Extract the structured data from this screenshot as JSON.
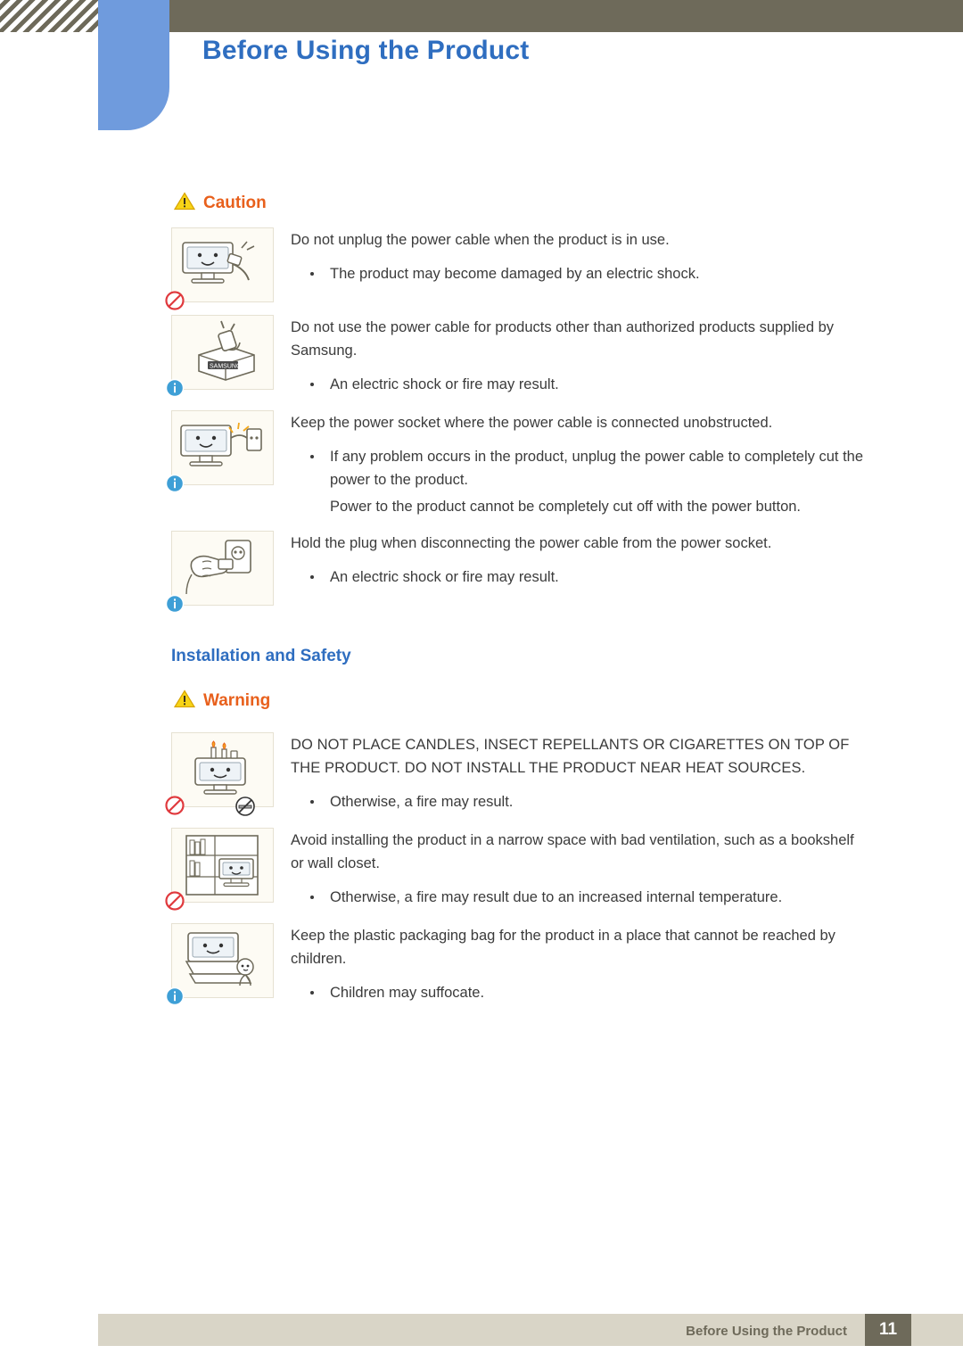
{
  "header": {
    "title": "Before Using the Product"
  },
  "sections": [
    {
      "flag": "Caution",
      "flag_icon": "warning-triangle-icon",
      "flag_color": "#e8601c",
      "entries": [
        {
          "image": "monitor-unplug-cable-icon",
          "badges": [
            "prohibition-icon"
          ],
          "lead": "Do not unplug the power cable when the product is in use.",
          "bullets": [
            "The product may become damaged by an electric shock."
          ],
          "extra": ""
        },
        {
          "image": "power-plug-box-icon",
          "badges": [
            "info-icon"
          ],
          "lead": "Do not use the power cable for products other than authorized products supplied by Samsung.",
          "bullets": [
            "An electric shock or fire may result."
          ],
          "extra": ""
        },
        {
          "image": "monitor-socket-access-icon",
          "badges": [
            "info-icon"
          ],
          "lead": "Keep the power socket where the power cable is connected unobstructed.",
          "bullets": [
            "If any problem occurs in the product, unplug the power cable to completely cut the power to the product."
          ],
          "extra": "Power to the product cannot be completely cut off with the power button."
        },
        {
          "image": "hand-holding-plug-icon",
          "badges": [
            "info-icon"
          ],
          "lead": "Hold the plug when disconnecting the power cable from the power socket.",
          "bullets": [
            "An electric shock or fire may result."
          ],
          "extra": ""
        }
      ]
    }
  ],
  "subheading": "Installation and Safety",
  "warning_section": {
    "flag": "Warning",
    "flag_icon": "warning-triangle-icon",
    "entries": [
      {
        "image": "candles-on-monitor-icon",
        "badges": [
          "prohibition-icon",
          "no-smoking-icon"
        ],
        "lead": "DO NOT PLACE CANDLES, INSECT REPELLANTS OR CIGARETTES ON TOP OF THE PRODUCT. DO NOT INSTALL THE PRODUCT NEAR HEAT SOURCES.",
        "bullets": [
          "Otherwise, a fire may result."
        ],
        "extra": ""
      },
      {
        "image": "monitor-in-bookshelf-icon",
        "badges": [
          "prohibition-icon"
        ],
        "lead": "Avoid installing the product in a narrow space with bad ventilation, such as a bookshelf or wall closet.",
        "bullets": [
          "Otherwise, a fire may result due to an increased internal temperature."
        ],
        "extra": ""
      },
      {
        "image": "child-with-packaging-bag-icon",
        "badges": [
          "info-icon"
        ],
        "lead": "Keep the plastic packaging bag for the product in a place that cannot be reached by children.",
        "bullets": [
          "Children may suffocate."
        ],
        "extra": ""
      }
    ]
  },
  "footer": {
    "label": "Before Using the Product",
    "page": "11"
  },
  "colors": {
    "header_bar": "#6e6a5a",
    "blue_tab": "#6f9bdd",
    "title_blue": "#2f6ec0",
    "accent_orange": "#e8601c",
    "footer_strip": "#d9d5c7"
  }
}
